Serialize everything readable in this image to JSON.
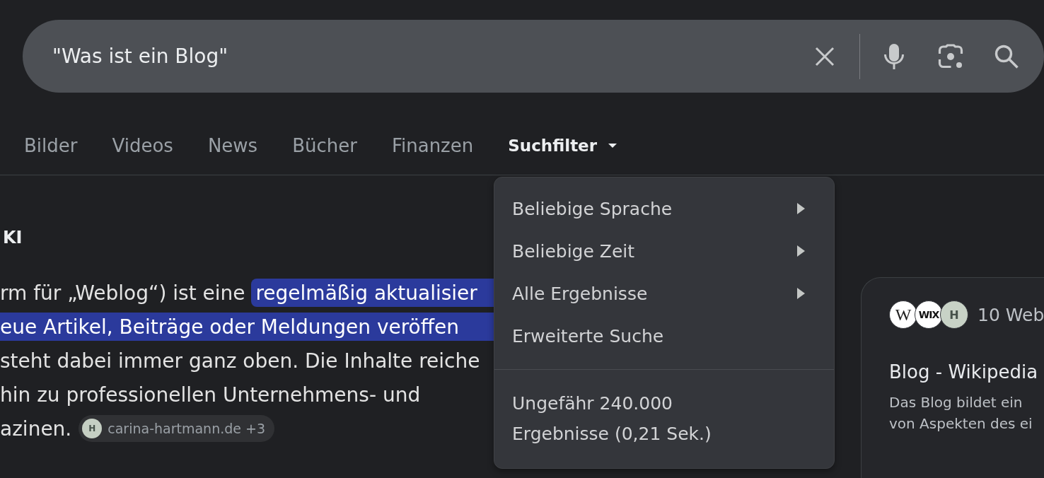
{
  "search": {
    "query": "\"Was ist ein Blog\""
  },
  "tabs": [
    {
      "label": "Bilder",
      "selected": false
    },
    {
      "label": "Videos",
      "selected": false
    },
    {
      "label": "News",
      "selected": false
    },
    {
      "label": "Bücher",
      "selected": false
    },
    {
      "label": "Finanzen",
      "selected": false
    }
  ],
  "filter_menu": {
    "label": "Suchfilter",
    "expanded": true,
    "items": [
      {
        "label": "Beliebige Sprache",
        "submenu": true
      },
      {
        "label": "Beliebige Zeit",
        "submenu": true
      },
      {
        "label": "Alle Ergebnisse",
        "submenu": true
      },
      {
        "label": "Erweiterte Suche",
        "submenu": false
      }
    ],
    "result_stats": "Ungefähr 240.000 Ergebnisse (0,21 Sek.)"
  },
  "ai_overview": {
    "heading": "KI",
    "lines": [
      {
        "segments": [
          {
            "text": "rm für „Weblog“) ist eine ",
            "highlighted": false
          },
          {
            "text": "regelmäßig aktualisier",
            "highlighted": true
          }
        ]
      },
      {
        "segments": [
          {
            "text": "eue Artikel, Beiträge oder Meldungen veröffen",
            "highlighted": true
          }
        ]
      },
      {
        "segments": [
          {
            "text": "steht dabei immer ganz oben. Die Inhalte reiche",
            "highlighted": false
          }
        ]
      },
      {
        "segments": [
          {
            "text": "hin zu professionellen Unternehmens- und",
            "highlighted": false
          }
        ]
      },
      {
        "segments": [
          {
            "text": "azinen.",
            "highlighted": false
          }
        ]
      }
    ],
    "source_chip": {
      "logo_label": "H",
      "label": "carina-hartmann.de +3"
    }
  },
  "sources_card": {
    "logos": [
      {
        "label": "W",
        "kind": "serif"
      },
      {
        "label": "WIX",
        "kind": "wordmark"
      },
      {
        "label": "H",
        "kind": "monogram"
      }
    ],
    "count": "10 Web",
    "title": "Blog - Wikipedia",
    "snippet_lines": [
      "Das Blog bildet ein",
      "von Aspekten des ei"
    ]
  }
}
